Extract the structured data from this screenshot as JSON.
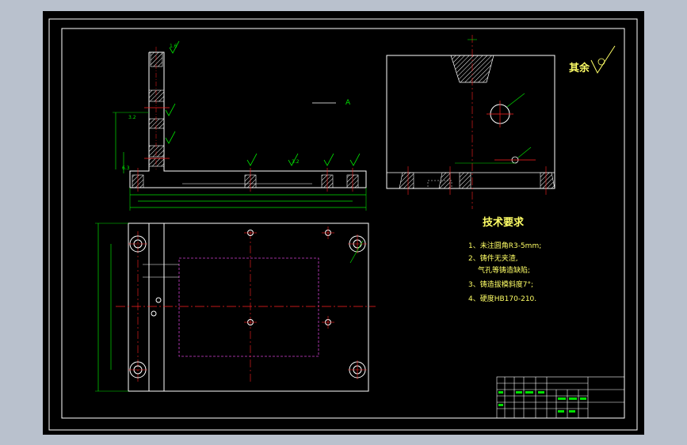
{
  "drawing": {
    "note_other": "其余",
    "tech_title": "技术要求",
    "tech_lines": [
      "1、未注圆角R3-5mm;",
      "2、铸件无夹渣,",
      "气孔等铸造缺陷;",
      "3、铸造拔模斜度7°;",
      "4、硬度HB170-210."
    ],
    "section_mark": "A",
    "dim_top_center": "6.3",
    "dim_side_a": "3.2",
    "dim_side_b": "6.3",
    "dim_surface": "3.2",
    "dim_small": "1.6",
    "colors": {
      "background": "#000000",
      "outline": "#ffffff",
      "centerline": "#ff2020",
      "dimension": "#00e000",
      "hidden": "#d040d0",
      "text": "#ffff66",
      "page": "#b9c1cd"
    }
  }
}
